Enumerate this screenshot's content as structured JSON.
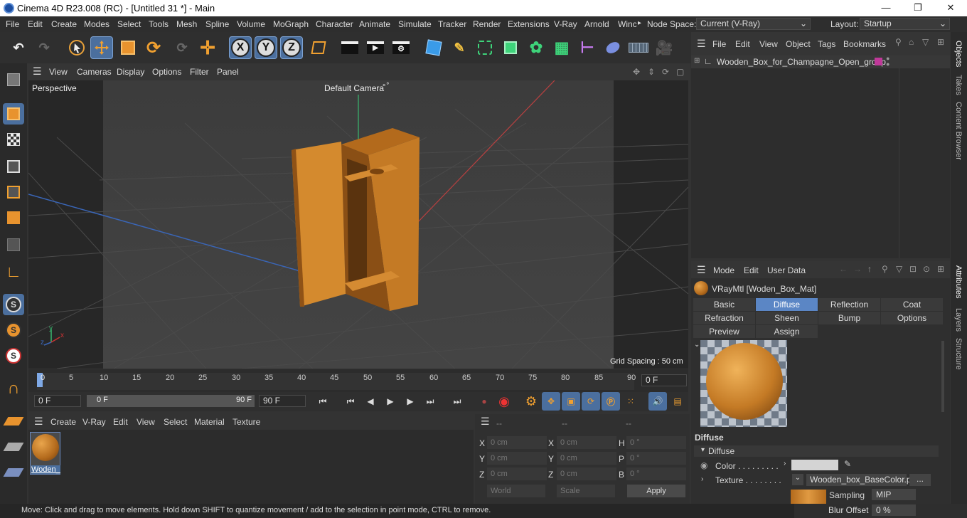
{
  "window": {
    "title": "Cinema 4D R23.008 (RC) - [Untitled 31 *] - Main",
    "minimize": "—",
    "maximize": "❐",
    "close": "✕"
  },
  "menu": [
    "File",
    "Edit",
    "Create",
    "Modes",
    "Select",
    "Tools",
    "Mesh",
    "Spline",
    "Volume",
    "MoGraph",
    "Character",
    "Animate",
    "Simulate",
    "Tracker",
    "Render",
    "Extensions",
    "V-Ray",
    "Arnold",
    "Winc"
  ],
  "menu_more": "▸",
  "node_space": {
    "label": "Node Space:",
    "value": "Current (V-Ray)"
  },
  "layout": {
    "label": "Layout:",
    "value": "Startup"
  },
  "toolbar": {
    "x": "X",
    "y": "Y",
    "z": "Z"
  },
  "viewport_menu": [
    "View",
    "Cameras",
    "Display",
    "Options",
    "Filter",
    "Panel"
  ],
  "viewport": {
    "name": "Perspective",
    "camera": "Default Camera",
    "camera_icon": "∘°",
    "grid_spacing": "Grid Spacing : 50 cm",
    "axis_x": "x",
    "axis_y": "y",
    "axis_z": "z"
  },
  "timeline": {
    "ticks": [
      "0",
      "5",
      "10",
      "15",
      "20",
      "25",
      "30",
      "35",
      "40",
      "45",
      "50",
      "55",
      "60",
      "65",
      "70",
      "75",
      "80",
      "85",
      "90"
    ],
    "frame": "0 F"
  },
  "transport": {
    "start": "0 F",
    "range_start": "0 F",
    "range_end": "90 F",
    "end": "90 F"
  },
  "material_menu": [
    "Create",
    "V-Ray",
    "Edit",
    "View",
    "Select",
    "Material",
    "Texture"
  ],
  "material": {
    "name": "Woden_"
  },
  "coord": {
    "headers": [
      "--",
      "--",
      "--"
    ],
    "rows": [
      {
        "a": "X",
        "av": "0 cm",
        "b": "X",
        "bv": "0 cm",
        "c": "H",
        "cv": "0 °"
      },
      {
        "a": "Y",
        "av": "0 cm",
        "b": "Y",
        "bv": "0 cm",
        "c": "P",
        "cv": "0 °"
      },
      {
        "a": "Z",
        "av": "0 cm",
        "b": "Z",
        "bv": "0 cm",
        "c": "B",
        "cv": "0 °"
      }
    ],
    "world": "World",
    "scale": "Scale",
    "apply": "Apply"
  },
  "objects_menu": [
    "File",
    "Edit",
    "View",
    "Object",
    "Tags",
    "Bookmarks"
  ],
  "object": {
    "name": "Wooden_Box_for_Champagne_Open_group",
    "tag_color": "#c0399a"
  },
  "attr_menu": [
    "Mode",
    "Edit",
    "User Data"
  ],
  "attr": {
    "title": "VRayMtl [Woden_Box_Mat]",
    "tabs": [
      "Basic",
      "Diffuse",
      "Reflection",
      "Coat",
      "Refraction",
      "Sheen",
      "Bump",
      "Options",
      "Preview Settings",
      "Assign"
    ],
    "active_tab": "Diffuse",
    "section": "Diffuse",
    "subsection": "Diffuse",
    "color_label": "Color . . . . . . . . .",
    "texture_label": "Texture . . . . . . . .",
    "texture_value": "Wooden_box_BaseColor.pn",
    "more": "...",
    "sampling_label": "Sampling",
    "sampling_value": "MIP",
    "blur_label": "Blur Offset",
    "blur_value": "0 %"
  },
  "right_tabs": [
    "Objects",
    "Takes",
    "Content Browser",
    "Attributes",
    "Layers",
    "Structure"
  ],
  "status": "Move: Click and drag to move elements. Hold down SHIFT to quantize movement / add to the selection in point mode, CTRL to remove."
}
